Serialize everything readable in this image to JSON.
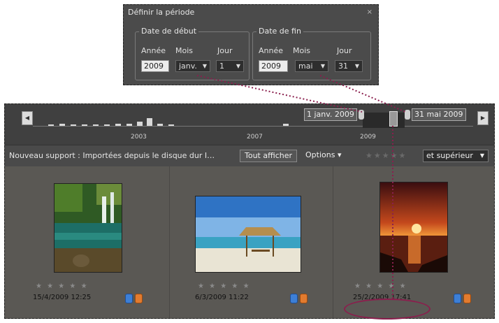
{
  "dialog": {
    "title": "Définir la période",
    "close_label": "×",
    "start": {
      "legend": "Date de début",
      "year_label": "Année",
      "month_label": "Mois",
      "day_label": "Jour",
      "year_value": "2009",
      "month_value": "janv.",
      "day_value": "1"
    },
    "end": {
      "legend": "Date de fin",
      "year_label": "Année",
      "month_label": "Mois",
      "day_label": "Jour",
      "year_value": "2009",
      "month_value": "mai",
      "day_value": "31"
    }
  },
  "timeline": {
    "years": [
      "2003",
      "2007",
      "2009"
    ],
    "start_callout": "1 janv. 2009",
    "end_callout": "31 mai 2009"
  },
  "toolbar": {
    "source_text": "Nouveau support : Importées depuis le disque dur I…",
    "show_all_label": "Tout afficher",
    "options_label": "Options ▾",
    "rating_filter": "et supérieur"
  },
  "photos": [
    {
      "date": "15/4/2009 12:25",
      "stars": "★ ★ ★ ★ ★"
    },
    {
      "date": "6/3/2009 11:22",
      "stars": "★ ★ ★ ★ ★"
    },
    {
      "date": "25/2/2009 17:41",
      "stars": "★ ★ ★ ★ ★"
    }
  ],
  "colors": {
    "callout_line": "#8a1f4d",
    "panel_bg": "#5a5854"
  }
}
